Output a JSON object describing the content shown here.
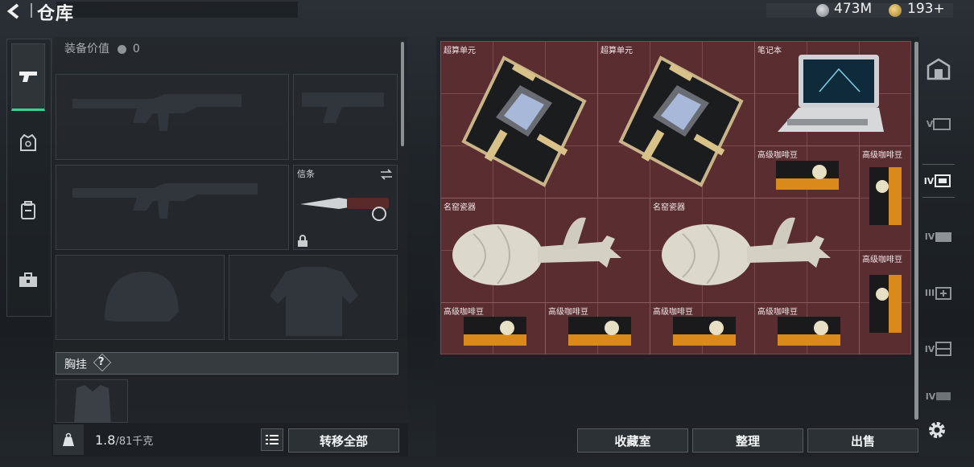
{
  "header": {
    "title": "仓库",
    "currency_silver": "473M",
    "currency_gold": "193+"
  },
  "loadout": {
    "equip_value_label": "装备价值",
    "equip_value": "0",
    "melee_slot_label": "信条",
    "chest_rig_label": "胸挂",
    "chest_rig_help": "?"
  },
  "footer_left": {
    "weight_current": "1.8",
    "weight_max": "/81千克",
    "transfer_all": "转移全部"
  },
  "storage": {
    "items": [
      {
        "name": "超算单元",
        "icon": "supercomputer-board"
      },
      {
        "name": "超算单元",
        "icon": "supercomputer-board"
      },
      {
        "name": "笔记本",
        "icon": "laptop"
      },
      {
        "name": "高级咖啡豆",
        "icon": "coffee-bag"
      },
      {
        "name": "高级咖啡豆",
        "icon": "coffee-bag"
      },
      {
        "name": "名窑瓷器",
        "icon": "porcelain-vase"
      },
      {
        "name": "名窑瓷器",
        "icon": "porcelain-vase"
      },
      {
        "name": "高级咖啡豆",
        "icon": "coffee-bag"
      },
      {
        "name": "高级咖啡豆",
        "icon": "coffee-bag"
      },
      {
        "name": "高级咖啡豆",
        "icon": "coffee-bag"
      },
      {
        "name": "高级咖啡豆",
        "icon": "coffee-bag"
      },
      {
        "name": "高级咖啡豆",
        "icon": "coffee-bag"
      }
    ]
  },
  "footer_right": {
    "collection": "收藏室",
    "organize": "整理",
    "sell": "出售"
  },
  "right_tabs": [
    "V",
    "IV",
    "IV",
    "III",
    "IV",
    "IV"
  ],
  "colors": {
    "accent": "#39d190",
    "grid_bg": "#5a2d31",
    "panel": "#22262a"
  }
}
